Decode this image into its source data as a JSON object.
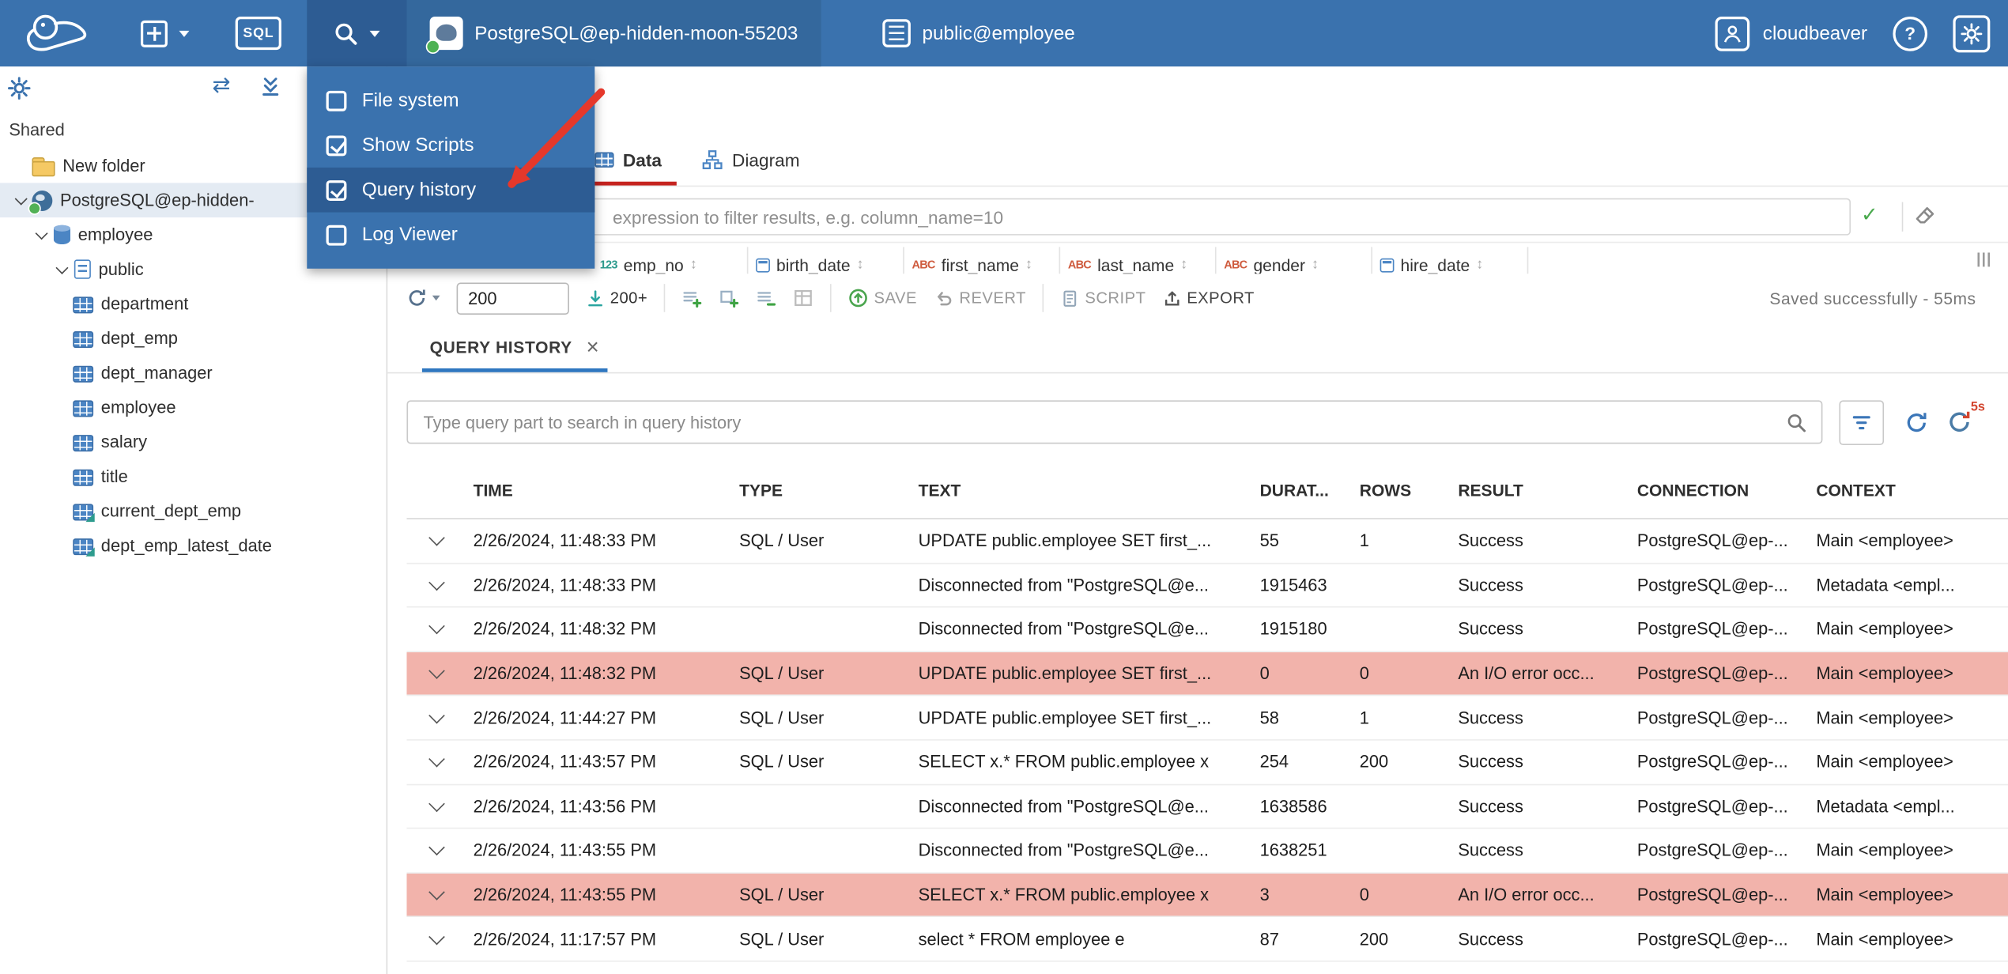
{
  "colors": {
    "c_topbar": "#3a72ae",
    "c_menu_hl": "#2d5c93",
    "c_tab_red": "#c5231f",
    "c_qh_accent": "#2f77c0",
    "c_error_row": "#f2b3ab",
    "c_arrow": "#e5382b"
  },
  "icons": {
    "new_connection": "plus-square + chevron-down",
    "sql_editor": "sql-square",
    "tools": "magnifier + chevron-down",
    "user": "person",
    "help": "question-circle",
    "settings": "gear",
    "search": "magnifier",
    "filter": "funnel",
    "refresh": "circular-arrow",
    "auto_refresh": "circular-arrow with 5s badge",
    "apply_filter": "check",
    "clear_filter": "eraser",
    "sort": "up-down-arrow",
    "close": "x"
  },
  "topbar": {
    "sql_label": "SQL",
    "connection": "PostgreSQL@ep-hidden-moon-55203",
    "schema": "public@employee",
    "user": "cloudbeaver",
    "help_label": "?"
  },
  "tools_menu": {
    "items": [
      {
        "label": "File system",
        "checked": false,
        "active": false
      },
      {
        "label": "Show Scripts",
        "checked": true,
        "active": false
      },
      {
        "label": "Query history",
        "checked": true,
        "active": true
      },
      {
        "label": "Log Viewer",
        "checked": false,
        "active": false
      }
    ]
  },
  "sidebar": {
    "section_label": "Shared",
    "tree": [
      {
        "label": "New folder",
        "icon": "folder",
        "indent": 0,
        "expandable": false,
        "selected": false
      },
      {
        "label": "PostgreSQL@ep-hidden-",
        "icon": "postgres",
        "indent": 0,
        "expandable": true,
        "selected": true
      },
      {
        "label": "employee",
        "icon": "database",
        "indent": 1,
        "expandable": true,
        "selected": false
      },
      {
        "label": "public",
        "icon": "schema",
        "indent": 2,
        "expandable": true,
        "selected": false
      },
      {
        "label": "department",
        "icon": "table",
        "indent": 2,
        "expandable": false,
        "selected": false
      },
      {
        "label": "dept_emp",
        "icon": "table",
        "indent": 2,
        "expandable": false,
        "selected": false
      },
      {
        "label": "dept_manager",
        "icon": "table",
        "indent": 2,
        "expandable": false,
        "selected": false
      },
      {
        "label": "employee",
        "icon": "table",
        "indent": 2,
        "expandable": false,
        "selected": false
      },
      {
        "label": "salary",
        "icon": "table",
        "indent": 2,
        "expandable": false,
        "selected": false
      },
      {
        "label": "title",
        "icon": "table",
        "indent": 2,
        "expandable": false,
        "selected": false
      },
      {
        "label": "current_dept_emp",
        "icon": "view",
        "indent": 2,
        "expandable": false,
        "selected": false
      },
      {
        "label": "dept_emp_latest_date",
        "icon": "view",
        "indent": 2,
        "expandable": false,
        "selected": false
      }
    ]
  },
  "object_panel": {
    "tabs": [
      {
        "label": "Data",
        "active": true
      },
      {
        "label": "Diagram",
        "active": false
      }
    ],
    "filter_placeholder": "expression to filter results, e.g. column_name=10",
    "apply_filter_glyph": "✓",
    "grid_columns": [
      {
        "name": "emp_no",
        "type": "number"
      },
      {
        "name": "birth_date",
        "type": "date"
      },
      {
        "name": "first_name",
        "type": "string"
      },
      {
        "name": "last_name",
        "type": "string"
      },
      {
        "name": "gender",
        "type": "string"
      },
      {
        "name": "hire_date",
        "type": "date"
      }
    ],
    "sort_glyph": "↕",
    "toolbar": {
      "row_limit": "200",
      "fetch_more": "200+",
      "save": "SAVE",
      "revert": "REVERT",
      "script": "SCRIPT",
      "export": "EXPORT",
      "status": "Saved successfully - 55ms"
    }
  },
  "query_history": {
    "tab_label": "QUERY HISTORY",
    "close_glyph": "×",
    "search_placeholder": "Type query part to search in query history",
    "auto_refresh_badge": "5s",
    "columns": [
      "TIME",
      "TYPE",
      "TEXT",
      "DURAT...",
      "ROWS",
      "RESULT",
      "CONNECTION",
      "CONTEXT"
    ],
    "rows": [
      {
        "time": "2/26/2024, 11:48:33 PM",
        "type": "SQL / User",
        "text": "UPDATE public.employee SET first_...",
        "duration": "55",
        "rows": "1",
        "result": "Success",
        "connection": "PostgreSQL@ep-...",
        "context": "Main <employee>",
        "error": false
      },
      {
        "time": "2/26/2024, 11:48:33 PM",
        "type": "",
        "text": "Disconnected from \"PostgreSQL@e...",
        "duration": "1915463",
        "rows": "",
        "result": "Success",
        "connection": "PostgreSQL@ep-...",
        "context": "Metadata <empl...",
        "error": false
      },
      {
        "time": "2/26/2024, 11:48:32 PM",
        "type": "",
        "text": "Disconnected from \"PostgreSQL@e...",
        "duration": "1915180",
        "rows": "",
        "result": "Success",
        "connection": "PostgreSQL@ep-...",
        "context": "Main <employee>",
        "error": false
      },
      {
        "time": "2/26/2024, 11:48:32 PM",
        "type": "SQL / User",
        "text": "UPDATE public.employee SET first_...",
        "duration": "0",
        "rows": "0",
        "result": "An I/O error occ...",
        "connection": "PostgreSQL@ep-...",
        "context": "Main <employee>",
        "error": true
      },
      {
        "time": "2/26/2024, 11:44:27 PM",
        "type": "SQL / User",
        "text": "UPDATE public.employee SET first_...",
        "duration": "58",
        "rows": "1",
        "result": "Success",
        "connection": "PostgreSQL@ep-...",
        "context": "Main <employee>",
        "error": false
      },
      {
        "time": "2/26/2024, 11:43:57 PM",
        "type": "SQL / User",
        "text": "SELECT x.* FROM public.employee x",
        "duration": "254",
        "rows": "200",
        "result": "Success",
        "connection": "PostgreSQL@ep-...",
        "context": "Main <employee>",
        "error": false
      },
      {
        "time": "2/26/2024, 11:43:56 PM",
        "type": "",
        "text": "Disconnected from \"PostgreSQL@e...",
        "duration": "1638586",
        "rows": "",
        "result": "Success",
        "connection": "PostgreSQL@ep-...",
        "context": "Metadata <empl...",
        "error": false
      },
      {
        "time": "2/26/2024, 11:43:55 PM",
        "type": "",
        "text": "Disconnected from \"PostgreSQL@e...",
        "duration": "1638251",
        "rows": "",
        "result": "Success",
        "connection": "PostgreSQL@ep-...",
        "context": "Main <employee>",
        "error": false
      },
      {
        "time": "2/26/2024, 11:43:55 PM",
        "type": "SQL / User",
        "text": "SELECT x.* FROM public.employee x",
        "duration": "3",
        "rows": "0",
        "result": "An I/O error occ...",
        "connection": "PostgreSQL@ep-...",
        "context": "Main <employee>",
        "error": true
      },
      {
        "time": "2/26/2024, 11:17:57 PM",
        "type": "SQL / User",
        "text": "select * FROM employee e",
        "duration": "87",
        "rows": "200",
        "result": "Success",
        "connection": "PostgreSQL@ep-...",
        "context": "Main <employee>",
        "error": false
      }
    ]
  }
}
